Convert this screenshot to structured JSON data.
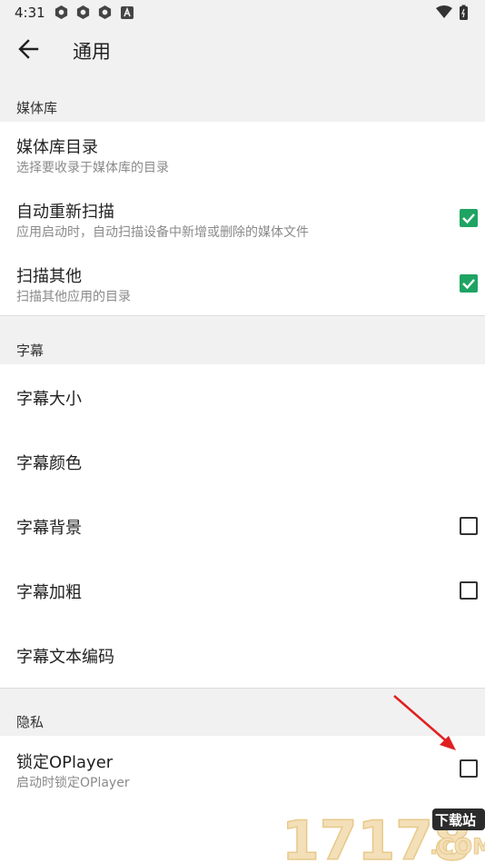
{
  "status": {
    "time": "4:31",
    "icons": [
      "sync-icon",
      "sync-icon",
      "sync-icon",
      "notification-a-icon",
      "wifi-icon",
      "battery-icon"
    ]
  },
  "toolbar": {
    "title": "通用"
  },
  "sections": [
    {
      "header": "媒体库",
      "items": [
        {
          "title": "媒体库目录",
          "subtitle": "选择要收录于媒体库的目录",
          "checkbox": "none"
        },
        {
          "title": "自动重新扫描",
          "subtitle": "应用启动时，自动扫描设备中新增或删除的媒体文件",
          "checkbox": "checked"
        },
        {
          "title": "扫描其他",
          "subtitle": "扫描其他应用的目录",
          "checkbox": "checked"
        }
      ]
    },
    {
      "header": "字幕",
      "items": [
        {
          "title": "字幕大小",
          "checkbox": "none"
        },
        {
          "title": "字幕颜色",
          "checkbox": "none"
        },
        {
          "title": "字幕背景",
          "checkbox": "unchecked"
        },
        {
          "title": "字幕加粗",
          "checkbox": "unchecked"
        },
        {
          "title": "字幕文本编码",
          "checkbox": "none"
        }
      ]
    },
    {
      "header": "隐私",
      "items": [
        {
          "title": "锁定OPlayer",
          "subtitle": "启动时锁定OPlayer",
          "checkbox": "unchecked"
        }
      ]
    }
  ],
  "watermark": {
    "number": "17178",
    "badge": "下载站",
    "domain": ".COM"
  },
  "colors": {
    "accent": "#1fa463",
    "annotation": "#e02020",
    "header_bg": "#f1f1f1"
  }
}
